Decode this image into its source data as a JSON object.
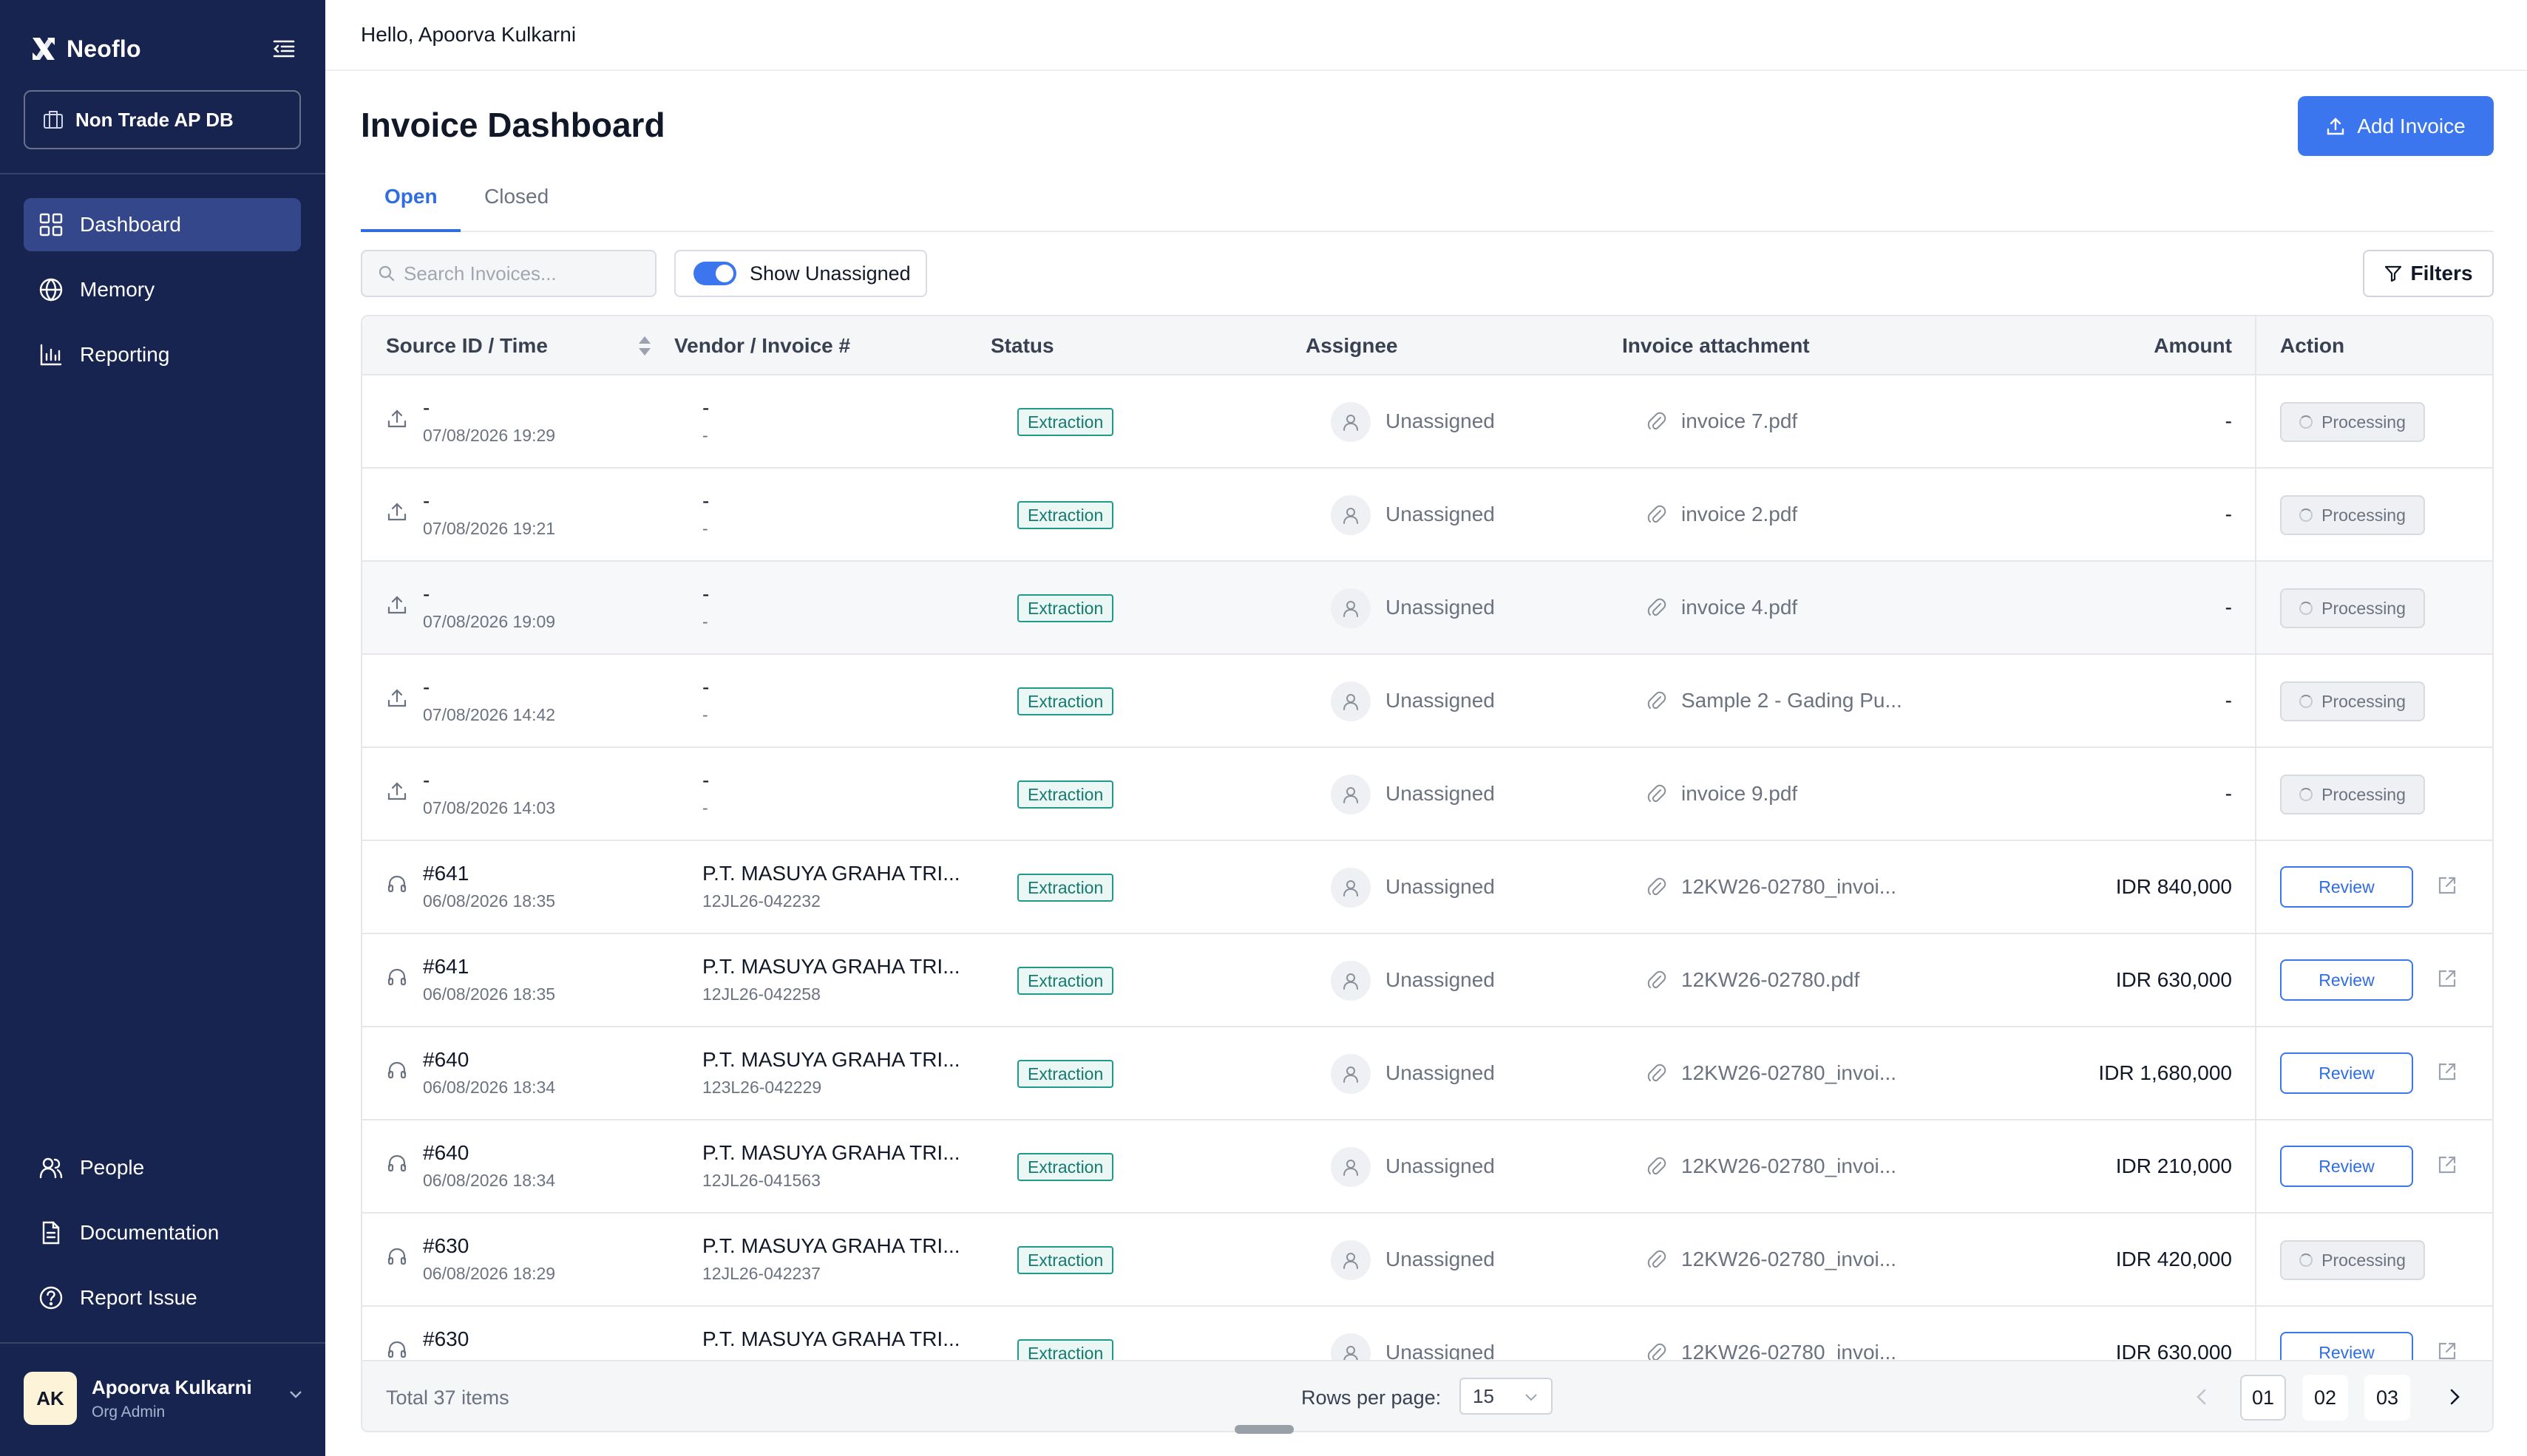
{
  "app": {
    "brand": "Neoflo",
    "workspace": "Non Trade AP DB"
  },
  "sidebar": {
    "nav": [
      {
        "label": "Dashboard",
        "icon": "grid-icon",
        "active": true
      },
      {
        "label": "Memory",
        "icon": "globe-icon",
        "active": false
      },
      {
        "label": "Reporting",
        "icon": "bar-chart-icon",
        "active": false
      }
    ],
    "bottom_nav": [
      {
        "label": "People",
        "icon": "people-icon"
      },
      {
        "label": "Documentation",
        "icon": "document-icon"
      },
      {
        "label": "Report Issue",
        "icon": "help-icon"
      }
    ],
    "user": {
      "initials": "AK",
      "name": "Apoorva Kulkarni",
      "role": "Org Admin"
    }
  },
  "header": {
    "greeting": "Hello, Apoorva Kulkarni"
  },
  "page": {
    "title": "Invoice Dashboard",
    "add_button": "Add Invoice",
    "tabs": [
      {
        "label": "Open",
        "active": true
      },
      {
        "label": "Closed",
        "active": false
      }
    ],
    "search_placeholder": "Search Invoices...",
    "show_unassigned_label": "Show Unassigned",
    "show_unassigned_on": true,
    "filters_label": "Filters"
  },
  "table": {
    "columns": [
      "Source ID / Time",
      "Vendor / Invoice #",
      "Status",
      "Assignee",
      "Invoice attachment",
      "Amount",
      "Action"
    ],
    "rows": [
      {
        "source": "upload",
        "id": "-",
        "time": "07/08/2026 19:29",
        "vendor": "-",
        "invoice": "-",
        "status": "Extraction",
        "assignee": "Unassigned",
        "attachment": "invoice 7.pdf",
        "amount": "-",
        "action": "Processing"
      },
      {
        "source": "upload",
        "id": "-",
        "time": "07/08/2026 19:21",
        "vendor": "-",
        "invoice": "-",
        "status": "Extraction",
        "assignee": "Unassigned",
        "attachment": "invoice 2.pdf",
        "amount": "-",
        "action": "Processing"
      },
      {
        "source": "upload",
        "id": "-",
        "time": "07/08/2026 19:09",
        "vendor": "-",
        "invoice": "-",
        "status": "Extraction",
        "assignee": "Unassigned",
        "attachment": "invoice 4.pdf",
        "amount": "-",
        "action": "Processing"
      },
      {
        "source": "upload",
        "id": "-",
        "time": "07/08/2026 14:42",
        "vendor": "-",
        "invoice": "-",
        "status": "Extraction",
        "assignee": "Unassigned",
        "attachment": "Sample 2 - Gading Pu...",
        "amount": "-",
        "action": "Processing"
      },
      {
        "source": "upload",
        "id": "-",
        "time": "07/08/2026 14:03",
        "vendor": "-",
        "invoice": "-",
        "status": "Extraction",
        "assignee": "Unassigned",
        "attachment": "invoice 9.pdf",
        "amount": "-",
        "action": "Processing"
      },
      {
        "source": "support",
        "id": "#641",
        "time": "06/08/2026 18:35",
        "vendor": "P.T. MASUYA GRAHA TRI...",
        "invoice": "12JL26-042232",
        "status": "Extraction",
        "assignee": "Unassigned",
        "attachment": "12KW26-02780_invoi...",
        "amount": "IDR 840,000",
        "action": "Review"
      },
      {
        "source": "support",
        "id": "#641",
        "time": "06/08/2026 18:35",
        "vendor": "P.T. MASUYA GRAHA TRI...",
        "invoice": "12JL26-042258",
        "status": "Extraction",
        "assignee": "Unassigned",
        "attachment": "12KW26-02780.pdf",
        "amount": "IDR 630,000",
        "action": "Review"
      },
      {
        "source": "support",
        "id": "#640",
        "time": "06/08/2026 18:34",
        "vendor": "P.T. MASUYA GRAHA TRI...",
        "invoice": "123L26-042229",
        "status": "Extraction",
        "assignee": "Unassigned",
        "attachment": "12KW26-02780_invoi...",
        "amount": "IDR 1,680,000",
        "action": "Review"
      },
      {
        "source": "support",
        "id": "#640",
        "time": "06/08/2026 18:34",
        "vendor": "P.T. MASUYA GRAHA TRI...",
        "invoice": "12JL26-041563",
        "status": "Extraction",
        "assignee": "Unassigned",
        "attachment": "12KW26-02780_invoi...",
        "amount": "IDR 210,000",
        "action": "Review"
      },
      {
        "source": "support",
        "id": "#630",
        "time": "06/08/2026 18:29",
        "vendor": "P.T. MASUYA GRAHA TRI...",
        "invoice": "12JL26-042237",
        "status": "Extraction",
        "assignee": "Unassigned",
        "attachment": "12KW26-02780_invoi...",
        "amount": "IDR 420,000",
        "action": "Processing"
      },
      {
        "source": "support",
        "id": "#630",
        "time": "",
        "vendor": "P.T. MASUYA GRAHA TRI...",
        "invoice": "",
        "status": "Extraction",
        "assignee": "Unassigned",
        "attachment": "12KW26-02780_invoi...",
        "amount": "IDR 630,000",
        "action": "Review"
      }
    ],
    "footer": {
      "total": "Total 37 items",
      "rows_per_page_label": "Rows per page:",
      "rows_per_page": "15",
      "pages": [
        "01",
        "02",
        "03"
      ],
      "current_page": "01"
    }
  },
  "colors": {
    "sidebar_bg": "#17244f",
    "sidebar_active": "#34478a",
    "primary": "#3b76ee",
    "status_teal": "#1f9a8a"
  }
}
